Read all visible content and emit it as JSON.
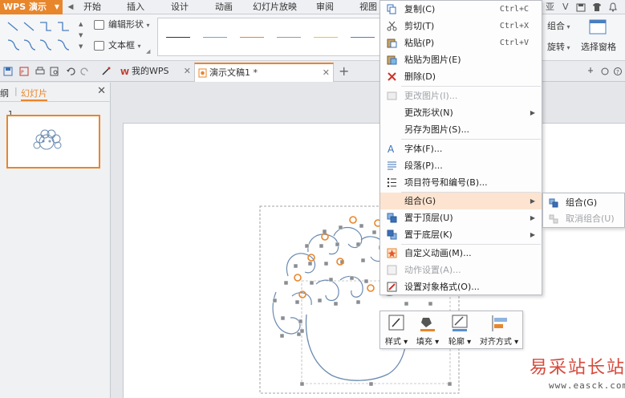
{
  "app": {
    "name": "WPS 演示"
  },
  "menubar": {
    "tabs": [
      "开始",
      "插入",
      "设计",
      "动画",
      "幻灯片放映",
      "审阅",
      "视图"
    ],
    "right": [
      "亚",
      "V"
    ]
  },
  "ribbon": {
    "edit_shape": "编辑形状",
    "text_box": "文本框",
    "group": "组合",
    "rotate": "旋转",
    "selection_pane": "选择窗格",
    "line_colors": [
      "#333333",
      "#6fa3d8",
      "#e8862c",
      "#9a9a9a",
      "#f2c230",
      "#4a7fc0"
    ]
  },
  "doc_tabs": [
    {
      "label": "我的WPS",
      "active": false
    },
    {
      "label": "演示文稿1 *",
      "active": true
    }
  ],
  "left_panel": {
    "tabs": [
      "纲",
      "幻灯片"
    ],
    "slide_number": "1"
  },
  "context_menu": {
    "items": [
      {
        "label": "复制(C)",
        "shortcut": "Ctrl+C",
        "icon": "copy-icon",
        "disabled": false
      },
      {
        "label": "剪切(T)",
        "shortcut": "Ctrl+X",
        "icon": "scissors-icon",
        "disabled": false
      },
      {
        "label": "粘贴(P)",
        "shortcut": "Ctrl+V",
        "icon": "paste-icon",
        "disabled": false
      },
      {
        "label": "粘贴为图片(E)",
        "shortcut": "",
        "icon": "paste-image-icon",
        "disabled": false
      },
      {
        "label": "删除(D)",
        "shortcut": "",
        "icon": "delete-icon",
        "disabled": false
      },
      {
        "label": "更改图片(I)...",
        "shortcut": "",
        "icon": "change-picture-icon",
        "disabled": true
      },
      {
        "label": "更改形状(N)",
        "shortcut": "",
        "icon": "",
        "disabled": false,
        "submenu": true
      },
      {
        "label": "另存为图片(S)...",
        "shortcut": "",
        "icon": "",
        "disabled": false
      },
      {
        "label": "字体(F)...",
        "shortcut": "",
        "icon": "font-icon",
        "disabled": false
      },
      {
        "label": "段落(P)...",
        "shortcut": "",
        "icon": "paragraph-icon",
        "disabled": false
      },
      {
        "label": "项目符号和编号(B)...",
        "shortcut": "",
        "icon": "bullets-icon",
        "disabled": false
      },
      {
        "label": "组合(G)",
        "shortcut": "",
        "icon": "",
        "disabled": false,
        "submenu": true,
        "highlight": true
      },
      {
        "label": "置于顶层(U)",
        "shortcut": "",
        "icon": "bring-front-icon",
        "disabled": false,
        "submenu": true
      },
      {
        "label": "置于底层(K)",
        "shortcut": "",
        "icon": "send-back-icon",
        "disabled": false,
        "submenu": true
      },
      {
        "label": "自定义动画(M)...",
        "shortcut": "",
        "icon": "animation-icon",
        "disabled": false
      },
      {
        "label": "动作设置(A)...",
        "shortcut": "",
        "icon": "action-icon",
        "disabled": true
      },
      {
        "label": "设置对象格式(O)...",
        "shortcut": "",
        "icon": "format-icon",
        "disabled": false
      }
    ]
  },
  "group_submenu": {
    "items": [
      {
        "label": "组合(G)",
        "disabled": false
      },
      {
        "label": "取消组合(U)",
        "disabled": true
      }
    ]
  },
  "mini_toolbar": {
    "items": [
      "样式",
      "填充",
      "轮廓",
      "对齐方式"
    ]
  },
  "colors": {
    "accent": "#e8862c",
    "highlight": "#fce4d0"
  },
  "watermark": {
    "text": "易采站长站",
    "url": "www.easck.com"
  }
}
